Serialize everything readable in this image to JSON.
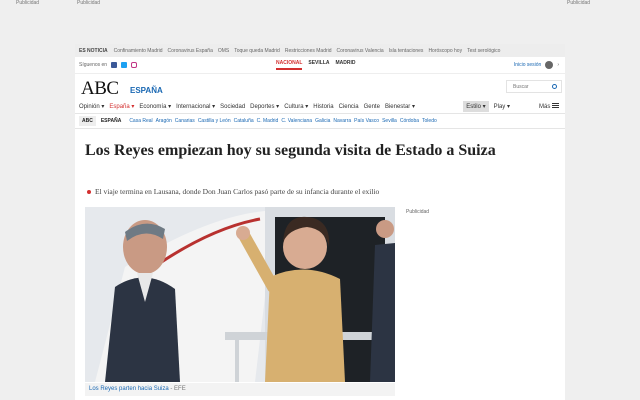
{
  "ads": {
    "label_left": "Publicidad",
    "label_center": "Publicidad",
    "label_right": "Publicidad",
    "label_side": "Publicidad"
  },
  "trending": {
    "label": "ES NOTICIA",
    "items": [
      "Confinamiento Madrid",
      "Coronavirus España",
      "OMS",
      "Toque queda Madrid",
      "Restricciones Madrid",
      "Coronavirus Valencia",
      "Isla tentaciones",
      "Horóscopo hoy",
      "Test serológico"
    ]
  },
  "utility": {
    "follow_label": "Síguenos en",
    "social_icons": [
      "facebook-icon",
      "twitter-icon",
      "instagram-icon"
    ],
    "editions": [
      "NACIONAL",
      "SEVILLA",
      "MADRID"
    ],
    "active_edition": "NACIONAL",
    "login_label": "Inicio sesión"
  },
  "brand": {
    "logo": "ABC",
    "section": "ESPAÑA",
    "search_placeholder": "Buscar"
  },
  "mainnav": {
    "items": [
      "Opinión ▾",
      "España ▾",
      "Economía ▾",
      "Internacional ▾",
      "Sociedad",
      "Deportes ▾",
      "Cultura ▾",
      "Historia",
      "Ciencia",
      "Gente",
      "Bienestar ▾"
    ],
    "active": "España ▾",
    "estilo": "Estilo ▾",
    "play": "Play ▾",
    "more": "Más"
  },
  "subnav": {
    "abc": "ABC",
    "espana": "ESPAÑA",
    "items": [
      "Casa Real",
      "Aragón",
      "Canarias",
      "Castilla y León",
      "Cataluña",
      "C. Madrid",
      "C. Valenciana",
      "Galicia",
      "Navarra",
      "País Vasco",
      "Sevilla",
      "Córdoba",
      "Toledo"
    ]
  },
  "article": {
    "headline": "Los Reyes empiezan hoy su segunda visita de Estado a Suiza",
    "subtitle": "El viaje termina en Lausana, donde Don Juan Carlos pasó parte de su infancia durante el exilio",
    "caption": "Los Reyes parten hacia Suiza",
    "credit": " - EFE"
  },
  "colors": {
    "accent": "#d32f2f",
    "link": "#1a68b3"
  }
}
